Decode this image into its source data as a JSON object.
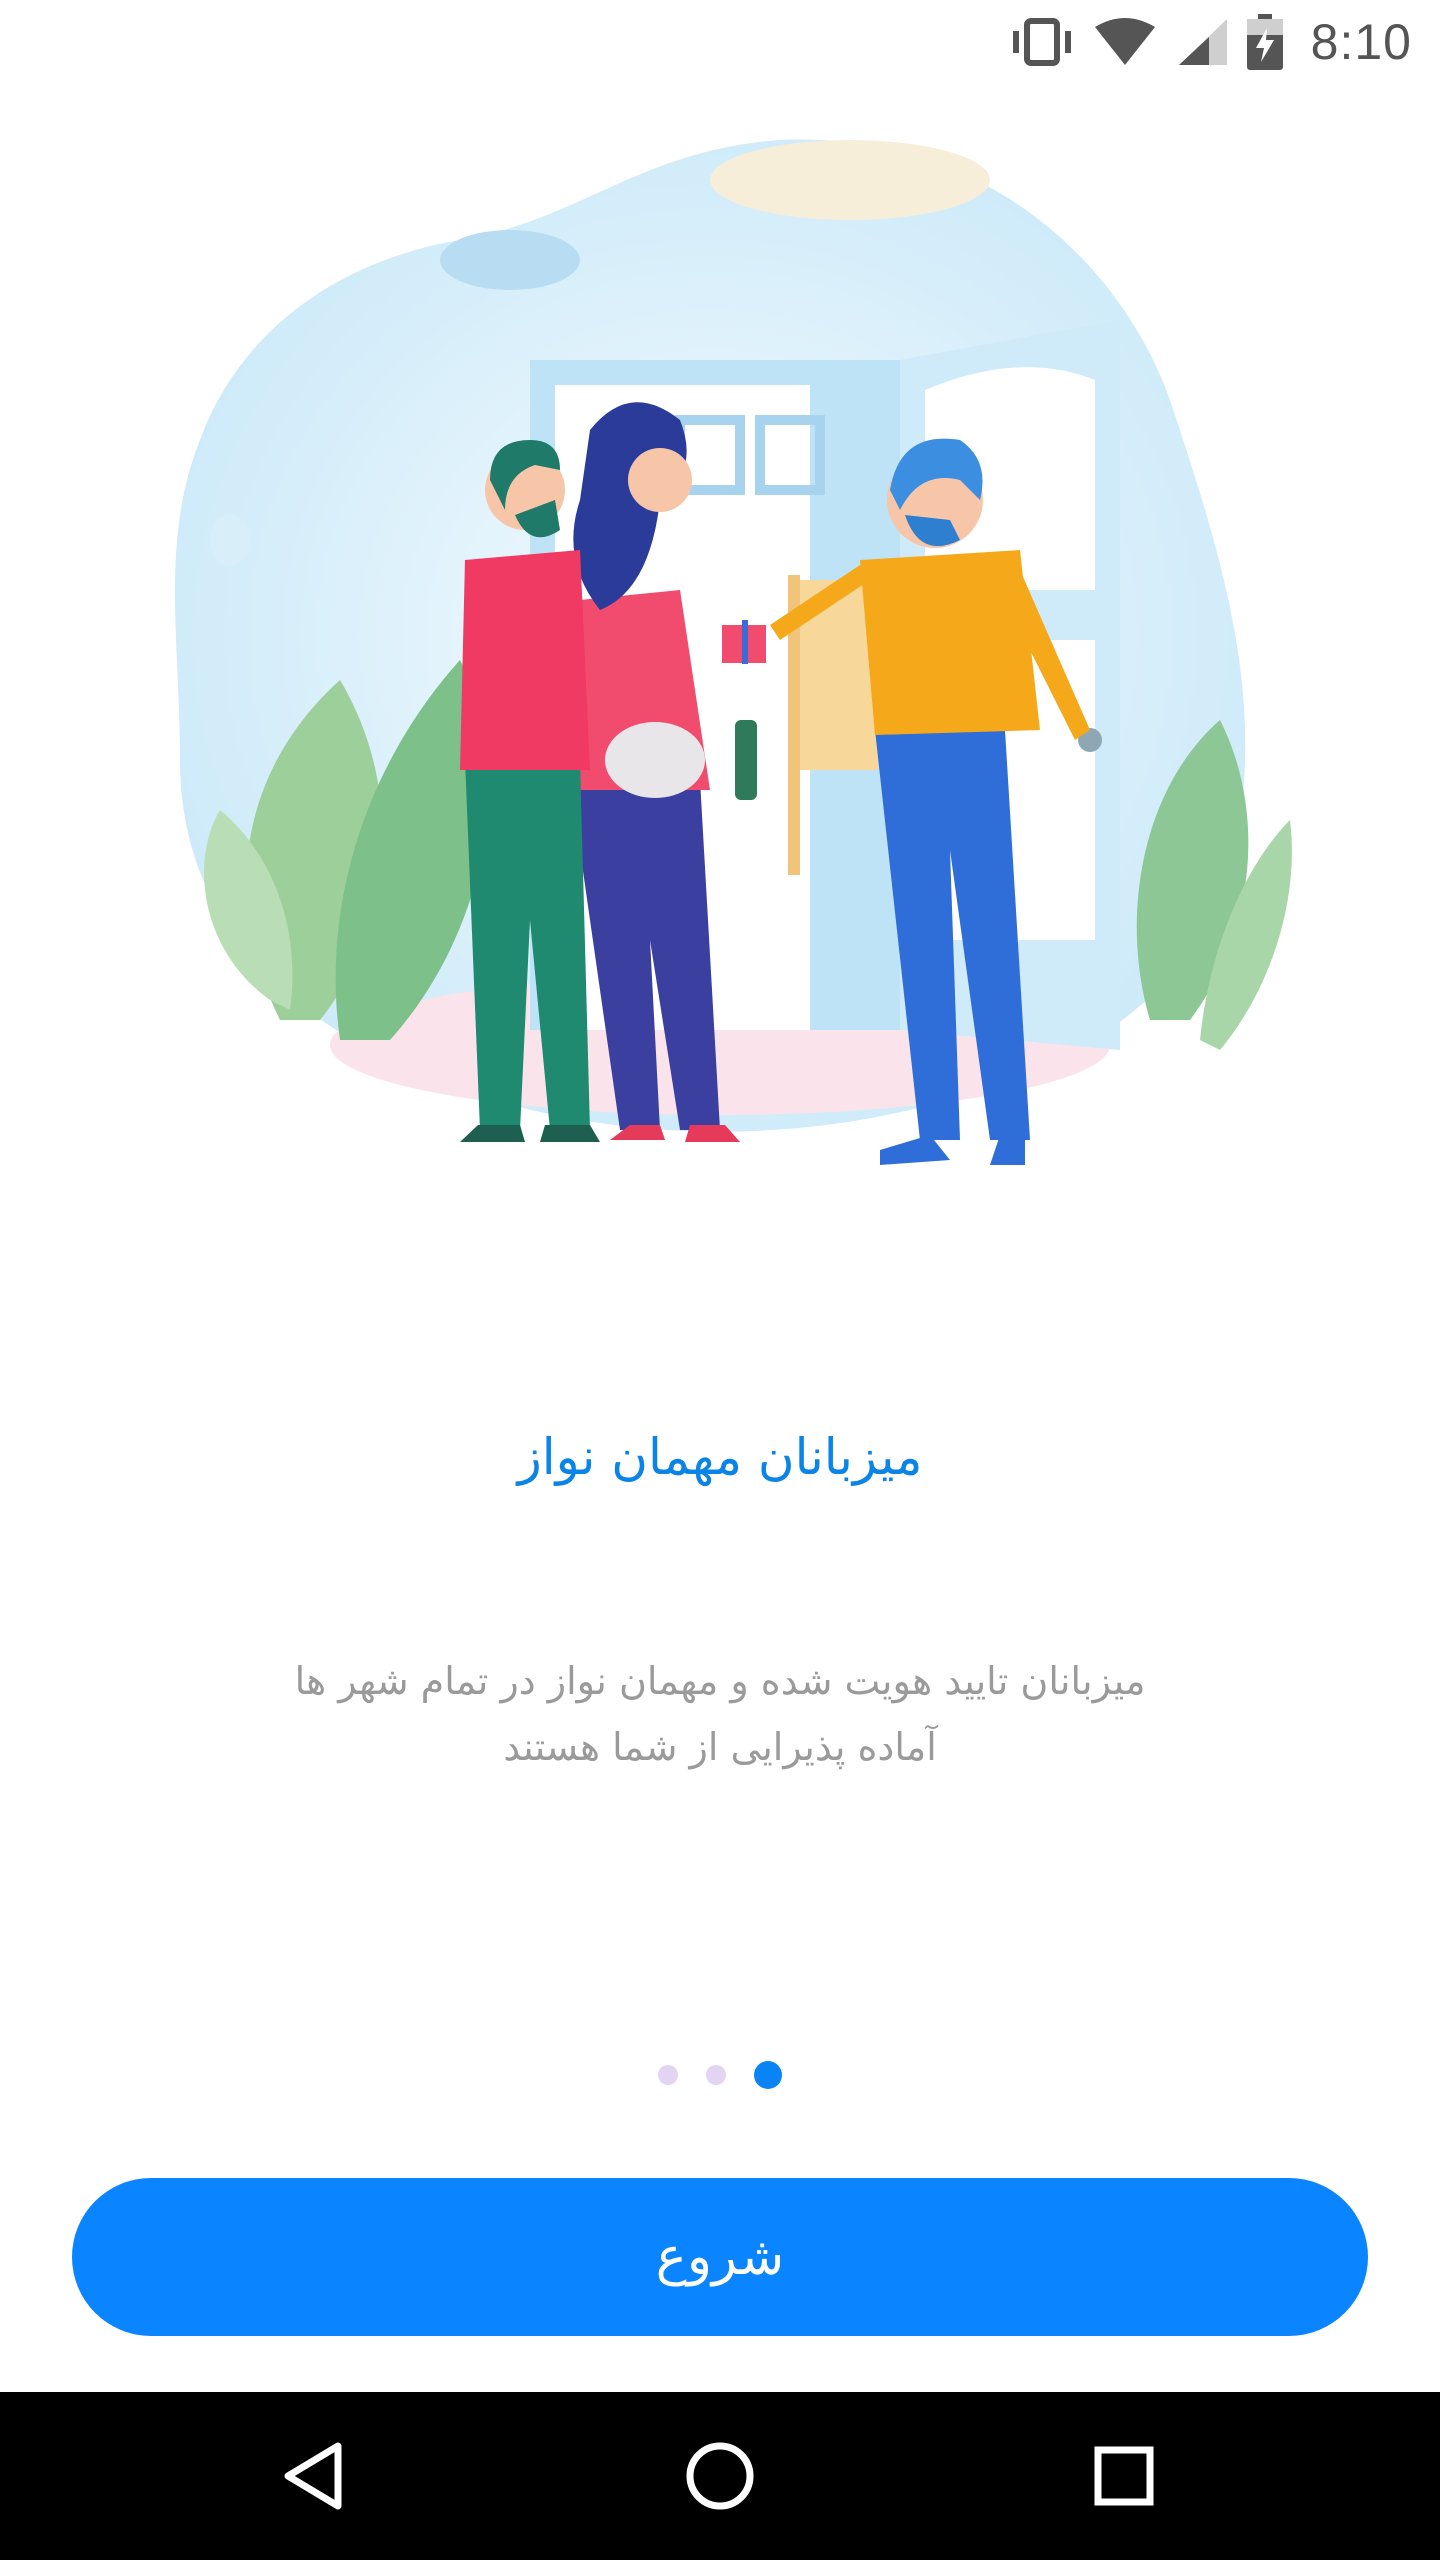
{
  "status_bar": {
    "time": "8:10",
    "icons": [
      "vibrate-icon",
      "wifi-icon",
      "cell-signal-icon",
      "battery-charging-icon"
    ]
  },
  "illustration": {
    "description_icon": "hosts-welcoming-guests-illustration"
  },
  "onboarding": {
    "title": "میزبانان مهمان نواز",
    "description_line1": "میزبانان تایید هویت شده و مهمان نواز در تمام شهر ها",
    "description_line2": "آماده پذیرایی از شما هستند",
    "page_count": 3,
    "active_page": 3
  },
  "start_button": {
    "label": "شروع"
  },
  "colors": {
    "accent": "#0a84ff",
    "title": "#0a84e6",
    "description": "#9a9a9a",
    "dot_inactive": "#e2d4f2"
  },
  "nav_bar": {
    "icons": [
      "back-icon",
      "home-icon",
      "recents-icon"
    ]
  }
}
